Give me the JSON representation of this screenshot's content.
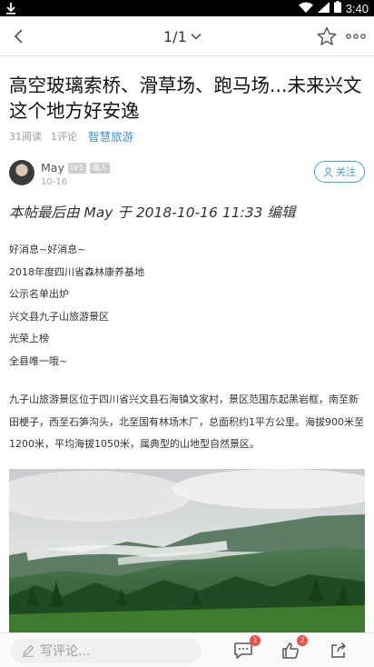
{
  "status_bar": {
    "time": "3:40"
  },
  "nav": {
    "page_indicator": "1/1"
  },
  "post": {
    "title": "高空玻璃索桥、滑草场、跑马场...未来兴文这个地方好安逸",
    "views": "31阅读",
    "comments": "1评论",
    "forum": "智慧旅游",
    "author": {
      "name": "May",
      "level_badge": "LV1",
      "role_badge": "路人",
      "date": "10-16"
    },
    "follow_label": "关注",
    "edit_note": "本帖最后由 May 于 2018-10-16 11:33 编辑",
    "lines": [
      "好消息~好消息~",
      "2018年度四川省森林康养基地",
      "公示名单出炉",
      "兴文县九子山旅游景区",
      "光荣上榜",
      "全县唯一哦~"
    ],
    "paragraph": "九子山旅游景区位于四川省兴文县石海镇文家村，景区范围东起黑岩框，南至新田梗子，西至石笋沟头，北至国有林场木厂，总面积约1平方公里。海拔900米至1200米，平均海拔1050米，属典型的山地型自然景区。"
  },
  "bottom_bar": {
    "comment_placeholder": "写评论...",
    "comment_count": "1",
    "like_count": "2"
  },
  "colors": {
    "accent": "#3fa6d8",
    "link": "#3f8fdc",
    "badge_red": "#f04b4b"
  }
}
